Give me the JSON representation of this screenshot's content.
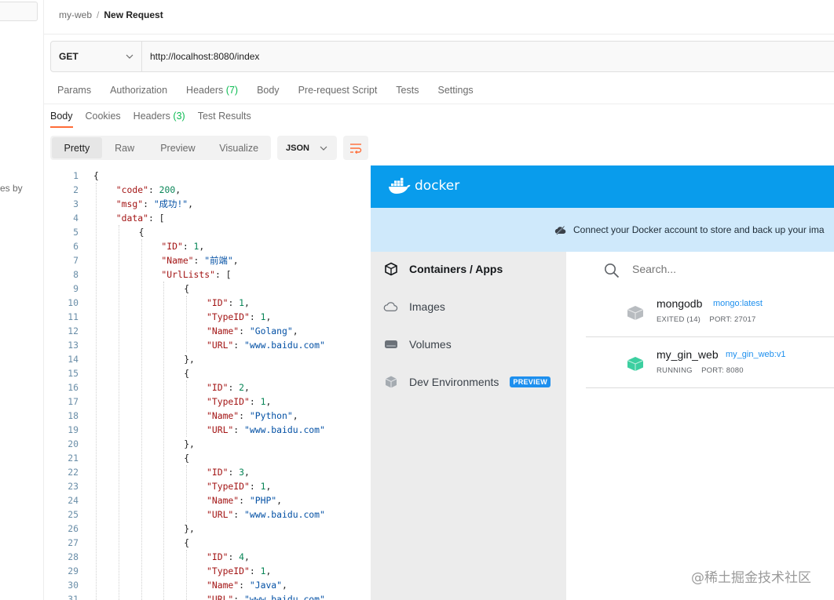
{
  "sidebar_stub": {
    "text": "es by"
  },
  "breadcrumb": {
    "collection": "my-web",
    "separator": "/",
    "request": "New Request"
  },
  "request": {
    "method": "GET",
    "url": "http://localhost:8080/index",
    "tabs": [
      {
        "label": "Params"
      },
      {
        "label": "Authorization"
      },
      {
        "label": "Headers",
        "count": "(7)"
      },
      {
        "label": "Body"
      },
      {
        "label": "Pre-request Script"
      },
      {
        "label": "Tests"
      },
      {
        "label": "Settings"
      }
    ]
  },
  "response": {
    "tabs": [
      {
        "label": "Body",
        "active": true
      },
      {
        "label": "Cookies"
      },
      {
        "label": "Headers",
        "count": "(3)"
      },
      {
        "label": "Test Results"
      }
    ],
    "view_modes": [
      "Pretty",
      "Raw",
      "Preview",
      "Visualize"
    ],
    "selected_view": "Pretty",
    "format": "JSON",
    "lines": [
      {
        "n": "1",
        "indent": 0,
        "t": [
          [
            "p",
            "{"
          ]
        ]
      },
      {
        "n": "2",
        "indent": 1,
        "t": [
          [
            "k",
            "\"code\""
          ],
          [
            "p",
            ": "
          ],
          [
            "n",
            "200"
          ],
          [
            "p",
            ","
          ]
        ]
      },
      {
        "n": "3",
        "indent": 1,
        "t": [
          [
            "k",
            "\"msg\""
          ],
          [
            "p",
            ": "
          ],
          [
            "s",
            "\"成功!\""
          ],
          [
            "p",
            ","
          ]
        ]
      },
      {
        "n": "4",
        "indent": 1,
        "t": [
          [
            "k",
            "\"data\""
          ],
          [
            "p",
            ": ["
          ]
        ]
      },
      {
        "n": "5",
        "indent": 2,
        "t": [
          [
            "p",
            "{"
          ]
        ]
      },
      {
        "n": "6",
        "indent": 3,
        "t": [
          [
            "k",
            "\"ID\""
          ],
          [
            "p",
            ": "
          ],
          [
            "n",
            "1"
          ],
          [
            "p",
            ","
          ]
        ]
      },
      {
        "n": "7",
        "indent": 3,
        "t": [
          [
            "k",
            "\"Name\""
          ],
          [
            "p",
            ": "
          ],
          [
            "s",
            "\"前端\""
          ],
          [
            "p",
            ","
          ]
        ]
      },
      {
        "n": "8",
        "indent": 3,
        "t": [
          [
            "k",
            "\"UrlLists\""
          ],
          [
            "p",
            ": ["
          ]
        ]
      },
      {
        "n": "9",
        "indent": 4,
        "t": [
          [
            "p",
            "{"
          ]
        ]
      },
      {
        "n": "10",
        "indent": 5,
        "t": [
          [
            "k",
            "\"ID\""
          ],
          [
            "p",
            ": "
          ],
          [
            "n",
            "1"
          ],
          [
            "p",
            ","
          ]
        ]
      },
      {
        "n": "11",
        "indent": 5,
        "t": [
          [
            "k",
            "\"TypeID\""
          ],
          [
            "p",
            ": "
          ],
          [
            "n",
            "1"
          ],
          [
            "p",
            ","
          ]
        ]
      },
      {
        "n": "12",
        "indent": 5,
        "t": [
          [
            "k",
            "\"Name\""
          ],
          [
            "p",
            ": "
          ],
          [
            "s",
            "\"Golang\""
          ],
          [
            "p",
            ","
          ]
        ]
      },
      {
        "n": "13",
        "indent": 5,
        "t": [
          [
            "k",
            "\"URL\""
          ],
          [
            "p",
            ": "
          ],
          [
            "s",
            "\"www.baidu.com\""
          ]
        ]
      },
      {
        "n": "14",
        "indent": 4,
        "t": [
          [
            "p",
            "},"
          ]
        ]
      },
      {
        "n": "15",
        "indent": 4,
        "t": [
          [
            "p",
            "{"
          ]
        ]
      },
      {
        "n": "16",
        "indent": 5,
        "t": [
          [
            "k",
            "\"ID\""
          ],
          [
            "p",
            ": "
          ],
          [
            "n",
            "2"
          ],
          [
            "p",
            ","
          ]
        ]
      },
      {
        "n": "17",
        "indent": 5,
        "t": [
          [
            "k",
            "\"TypeID\""
          ],
          [
            "p",
            ": "
          ],
          [
            "n",
            "1"
          ],
          [
            "p",
            ","
          ]
        ]
      },
      {
        "n": "18",
        "indent": 5,
        "t": [
          [
            "k",
            "\"Name\""
          ],
          [
            "p",
            ": "
          ],
          [
            "s",
            "\"Python\""
          ],
          [
            "p",
            ","
          ]
        ]
      },
      {
        "n": "19",
        "indent": 5,
        "t": [
          [
            "k",
            "\"URL\""
          ],
          [
            "p",
            ": "
          ],
          [
            "s",
            "\"www.baidu.com\""
          ]
        ]
      },
      {
        "n": "20",
        "indent": 4,
        "t": [
          [
            "p",
            "},"
          ]
        ]
      },
      {
        "n": "21",
        "indent": 4,
        "t": [
          [
            "p",
            "{"
          ]
        ]
      },
      {
        "n": "22",
        "indent": 5,
        "t": [
          [
            "k",
            "\"ID\""
          ],
          [
            "p",
            ": "
          ],
          [
            "n",
            "3"
          ],
          [
            "p",
            ","
          ]
        ]
      },
      {
        "n": "23",
        "indent": 5,
        "t": [
          [
            "k",
            "\"TypeID\""
          ],
          [
            "p",
            ": "
          ],
          [
            "n",
            "1"
          ],
          [
            "p",
            ","
          ]
        ]
      },
      {
        "n": "24",
        "indent": 5,
        "t": [
          [
            "k",
            "\"Name\""
          ],
          [
            "p",
            ": "
          ],
          [
            "s",
            "\"PHP\""
          ],
          [
            "p",
            ","
          ]
        ]
      },
      {
        "n": "25",
        "indent": 5,
        "t": [
          [
            "k",
            "\"URL\""
          ],
          [
            "p",
            ": "
          ],
          [
            "s",
            "\"www.baidu.com\""
          ]
        ]
      },
      {
        "n": "26",
        "indent": 4,
        "t": [
          [
            "p",
            "},"
          ]
        ]
      },
      {
        "n": "27",
        "indent": 4,
        "t": [
          [
            "p",
            "{"
          ]
        ]
      },
      {
        "n": "28",
        "indent": 5,
        "t": [
          [
            "k",
            "\"ID\""
          ],
          [
            "p",
            ": "
          ],
          [
            "n",
            "4"
          ],
          [
            "p",
            ","
          ]
        ]
      },
      {
        "n": "29",
        "indent": 5,
        "t": [
          [
            "k",
            "\"TypeID\""
          ],
          [
            "p",
            ": "
          ],
          [
            "n",
            "1"
          ],
          [
            "p",
            ","
          ]
        ]
      },
      {
        "n": "30",
        "indent": 5,
        "t": [
          [
            "k",
            "\"Name\""
          ],
          [
            "p",
            ": "
          ],
          [
            "s",
            "\"Java\""
          ],
          [
            "p",
            ","
          ]
        ]
      },
      {
        "n": "31",
        "indent": 5,
        "t": [
          [
            "k",
            "\"URL\""
          ],
          [
            "p",
            ": "
          ],
          [
            "s",
            "\"www.baidu.com\""
          ]
        ]
      }
    ]
  },
  "docker": {
    "logo_text": "docker",
    "banner": "Connect your Docker account to store and back up your ima",
    "nav": [
      {
        "label": "Containers / Apps",
        "icon": "containers-icon",
        "active": true
      },
      {
        "label": "Images",
        "icon": "cloud-icon"
      },
      {
        "label": "Volumes",
        "icon": "volume-icon"
      },
      {
        "label": "Dev Environments",
        "icon": "dev-env-icon",
        "badge": "PREVIEW"
      }
    ],
    "search_placeholder": "Search...",
    "containers": [
      {
        "name": "mongodb",
        "image": "mongo:latest",
        "status": "EXITED (14)",
        "port": "PORT: 27017",
        "state_color": "#b8bcc0"
      },
      {
        "name": "my_gin_web",
        "image": "my_gin_web:v1",
        "status": "RUNNING",
        "port": "PORT: 8080",
        "state_color": "#3ccfa0"
      }
    ]
  },
  "watermark": "@稀土掘金技术社区",
  "colors": {
    "accent": "#ff6c37",
    "count_green": "#0cbb52",
    "docker_blue": "#099cec"
  }
}
